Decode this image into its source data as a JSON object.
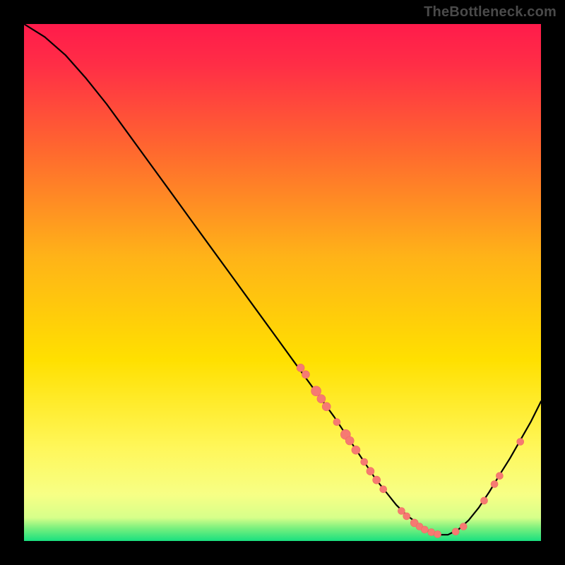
{
  "watermark": "TheBottleneck.com",
  "colors": {
    "bg": "#000000",
    "plot_top": "#ff1b4b",
    "plot_mid": "#ffe000",
    "plot_bottom": "#19e07f",
    "curve": "#000000",
    "dot_fill": "#f67a72",
    "dot_stroke": "#ef6a62",
    "watermark": "#4a4a4a"
  },
  "chart_data": {
    "type": "line",
    "title": "",
    "xlabel": "",
    "ylabel": "",
    "xlim": [
      0,
      100
    ],
    "ylim": [
      0,
      100
    ],
    "grid": false,
    "series": [
      {
        "name": "bottleneck-curve",
        "x": [
          0,
          4,
          8,
          12,
          16,
          20,
          24,
          28,
          32,
          36,
          40,
          44,
          48,
          52,
          56,
          60,
          62,
          64,
          66,
          68,
          70,
          72,
          74,
          76,
          78,
          80,
          82,
          84,
          86,
          88,
          90,
          92,
          94,
          96,
          98,
          100
        ],
        "y": [
          100,
          97.5,
          94,
          89.5,
          84.5,
          79,
          73.5,
          68,
          62.5,
          57,
          51.5,
          46,
          40.5,
          35,
          29.5,
          24,
          21,
          18,
          15,
          12,
          9.5,
          7,
          5,
          3.5,
          2,
          1.2,
          1.2,
          2.2,
          4,
          6.5,
          9.5,
          12.8,
          16,
          19.5,
          23,
          27
        ]
      }
    ],
    "scatter": [
      {
        "name": "highlight-points",
        "points": [
          {
            "x": 53.5,
            "y": 33.5,
            "r": 5.5
          },
          {
            "x": 54.5,
            "y": 32.2,
            "r": 5.5
          },
          {
            "x": 56.5,
            "y": 29.0,
            "r": 7.0
          },
          {
            "x": 57.5,
            "y": 27.5,
            "r": 6.0
          },
          {
            "x": 58.5,
            "y": 26.0,
            "r": 6.0
          },
          {
            "x": 60.5,
            "y": 23.0,
            "r": 5.0
          },
          {
            "x": 62.2,
            "y": 20.6,
            "r": 7.0
          },
          {
            "x": 63.0,
            "y": 19.4,
            "r": 6.0
          },
          {
            "x": 64.2,
            "y": 17.6,
            "r": 6.0
          },
          {
            "x": 65.8,
            "y": 15.3,
            "r": 5.0
          },
          {
            "x": 67.0,
            "y": 13.5,
            "r": 5.5
          },
          {
            "x": 68.2,
            "y": 11.8,
            "r": 5.5
          },
          {
            "x": 69.5,
            "y": 10.0,
            "r": 5.0
          },
          {
            "x": 73.0,
            "y": 5.8,
            "r": 5.0
          },
          {
            "x": 74.0,
            "y": 4.8,
            "r": 5.0
          },
          {
            "x": 75.5,
            "y": 3.5,
            "r": 5.5
          },
          {
            "x": 76.5,
            "y": 2.8,
            "r": 5.0
          },
          {
            "x": 77.5,
            "y": 2.2,
            "r": 5.0
          },
          {
            "x": 78.8,
            "y": 1.7,
            "r": 5.0
          },
          {
            "x": 80.0,
            "y": 1.3,
            "r": 5.0
          },
          {
            "x": 83.5,
            "y": 1.8,
            "r": 5.0
          },
          {
            "x": 85.0,
            "y": 2.8,
            "r": 5.0
          },
          {
            "x": 89.0,
            "y": 7.8,
            "r": 5.0
          },
          {
            "x": 91.0,
            "y": 11.0,
            "r": 5.0
          },
          {
            "x": 92.0,
            "y": 12.6,
            "r": 5.0
          },
          {
            "x": 96.0,
            "y": 19.2,
            "r": 5.0
          }
        ]
      }
    ]
  }
}
